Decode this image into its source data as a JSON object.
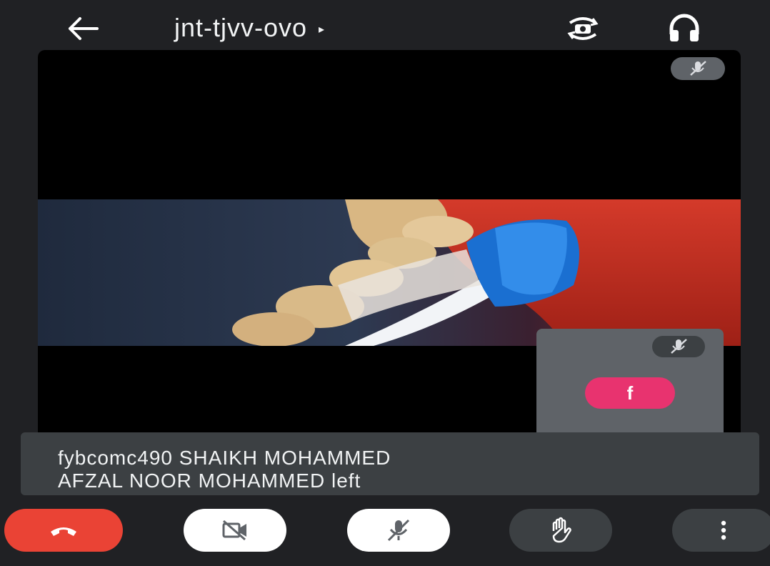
{
  "meeting": {
    "code": "jnt-tjvv-ovo",
    "caret": "▸"
  },
  "topbar": {
    "icons": [
      "arrow-left-icon",
      "switch-camera-icon",
      "headset-icon"
    ]
  },
  "self_tile": {
    "avatar_letter": "f",
    "avatar_color": "#e8336f"
  },
  "notification": {
    "line1": "fybcomc490 SHAIKH MOHAMMED",
    "line2": "AFZAL NOOR MOHAMMED left"
  },
  "controls": {
    "icons": [
      "phone-hangup-icon",
      "video-off-icon",
      "mic-off-icon",
      "raise-hand-icon",
      "more-vert-icon"
    ]
  },
  "colors": {
    "background": "#202124",
    "end_call": "#ea4335",
    "pill_dark": "#3c4043",
    "pill_gray": "#5f6368",
    "avatar": "#e8336f"
  }
}
